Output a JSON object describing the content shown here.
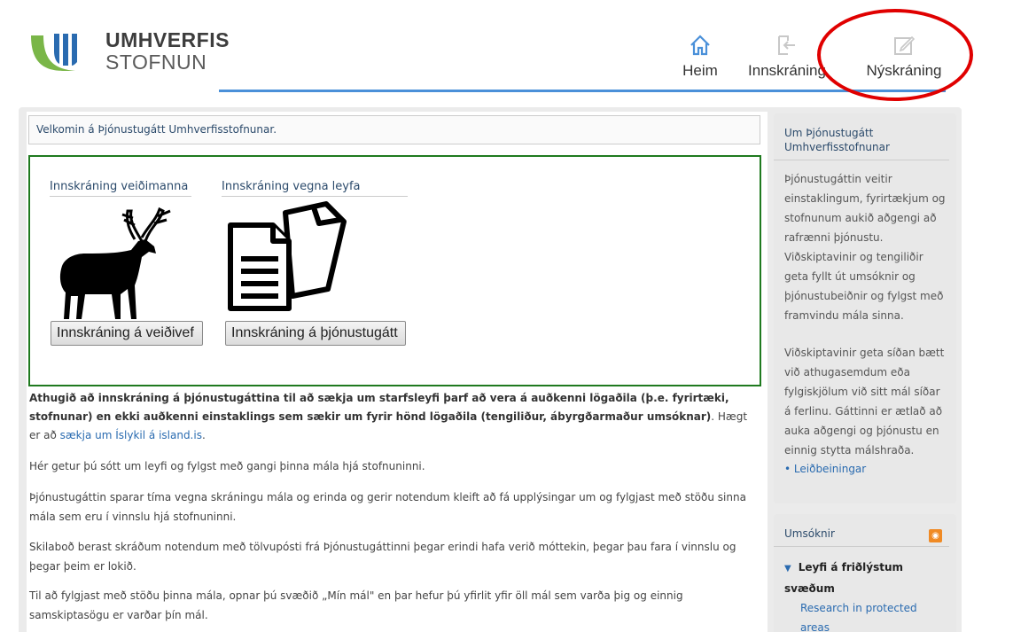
{
  "brand": {
    "line1": "UMHVERFIS",
    "line2": "STOFNUN"
  },
  "nav": {
    "home": "Heim",
    "login": "Innskráning",
    "register": "Nýskráning"
  },
  "welcome": "Velkomin á Þjónustugátt Umhverfisstofnunar.",
  "login_panel": {
    "hunters_title": "Innskráning veiðimanna",
    "permits_title": "Innskráning vegna leyfa",
    "hunters_button": "Innskráning á veiðivef",
    "portal_button": "Innskráning á þjónustugátt"
  },
  "notice": {
    "bold": "Athugið að innskráning á þjónustugáttina til að sækja um starfsleyfi þarf að vera á auðkenni lögaðila  (þ.e. fyrirtæki, stofnunar) en ekki auðkenni einstaklings sem sækir um fyrir hönd lögaðila (tengiliður, ábyrgðarmaður umsóknar)",
    "tail": ". Hægt er að ",
    "link": "sækja um Íslykil á island.is",
    "end": "."
  },
  "paragraphs": [
    "Hér getur þú sótt um leyfi og fylgst með gangi þinna mála hjá stofnuninni.",
    "Þjónustugáttin sparar tíma vegna skráningu mála og erinda og gerir notendum kleift að fá upplýsingar um og fylgjast með stöðu sinna mála sem eru í vinnslu hjá stofnuninni.",
    "Skilaboð berast skráðum notendum með tölvupósti frá Þjónustugáttinni þegar erindi hafa verið móttekin, þegar þau fara í vinnslu og þegar þeim er lokið.",
    "Til að fylgjast með stöðu þinna mála, opnar þú svæðið „Mín mál\" en þar hefur þú yfirlit yfir öll mál sem varða þig og einnig samskiptasögu er varðar þín mál."
  ],
  "sidebar": {
    "about_title": "Um Þjónustugátt Umhverfisstofnunar",
    "about_text1": "Þjónustugáttin veitir einstaklingum, fyrirtækjum og stofnunum aukið aðgengi að rafrænni þjónustu. Viðskiptavinir og tengiliðir geta fyllt út umsóknir og þjónustubeiðnir og fylgst með framvindu mála sinna.",
    "about_text2": "Viðskiptavinir geta síðan bætt við athugasemdum eða fylgiskjölum við sitt mál síðar á ferlinu. Gáttinni er ætlað að auka aðgengi og þjónustu en einnig stytta málshraða.",
    "guide_link": "Leiðbeiningar",
    "applications_title": "Umsóknir",
    "group_head": "Leyfi á friðlýstum svæðum",
    "group_item": "Research in protected areas"
  },
  "colors": {
    "accent": "#4a90d9",
    "green_border": "#1f7a1f",
    "highlight": "#e00000",
    "rss": "#f08a24"
  }
}
